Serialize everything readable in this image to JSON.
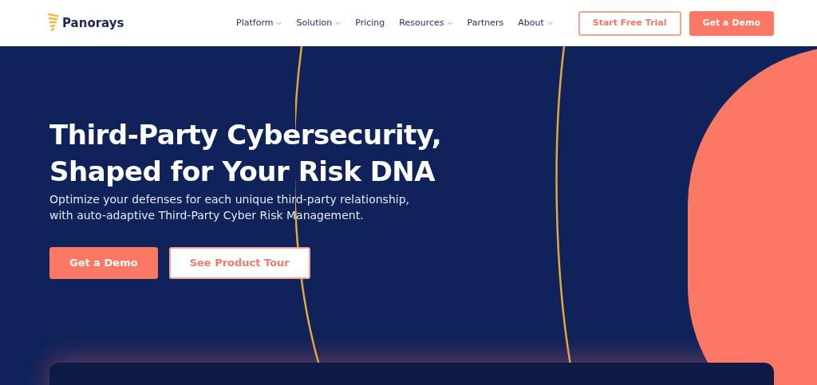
{
  "header": {
    "brand": "Panorays",
    "nav": [
      {
        "label": "Platform",
        "has_menu": true
      },
      {
        "label": "Solution",
        "has_menu": true
      },
      {
        "label": "Pricing",
        "has_menu": false
      },
      {
        "label": "Resources",
        "has_menu": true
      },
      {
        "label": "Partners",
        "has_menu": false
      },
      {
        "label": "About",
        "has_menu": true
      }
    ],
    "buttons": [
      {
        "label": "Start Free Trial",
        "kind": "outline"
      },
      {
        "label": "Get a Demo",
        "kind": "filled"
      }
    ]
  },
  "hero": {
    "title_lines": [
      "Third-Party Cybersecurity,",
      "Shaped for Your Risk DNA"
    ],
    "subtitle_lines": [
      "Optimize your defenses for each unique third-party relationship,",
      "with auto-adaptive Third-Party Cyber Risk Management."
    ],
    "buttons": [
      {
        "label": "Get a Demo",
        "kind": "filled"
      },
      {
        "label": "See Product Tour",
        "kind": "outline"
      }
    ]
  }
}
